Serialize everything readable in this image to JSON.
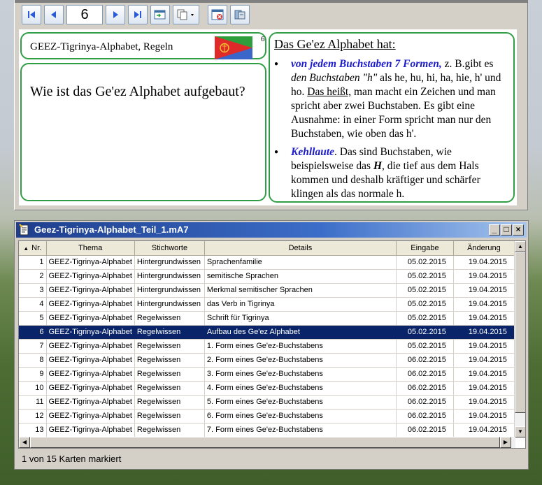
{
  "toolbar": {
    "page_number": "6",
    "buttons": [
      "first-page-icon",
      "prev-page-icon",
      "next-page-icon",
      "last-page-icon",
      "edit-card-icon",
      "copy-dropdown-icon",
      "close-card-icon",
      "export-icon"
    ]
  },
  "card": {
    "title": "GEEZ-Tigrinya-Alphabet, Regeln",
    "card_number": "6",
    "question": "Wie ist das Ge'ez Alphabet aufgebaut?",
    "answer_heading": "Das Ge'ez Alphabet hat:",
    "answer_items": [
      {
        "highlight": "von jedem Buchstaben 7 Formen,",
        "t1": " z. B.gibt es ",
        "italic": "den Buchstaben \"h\"",
        "t2": " als he, hu, hi, ha, hie, h' und ho. ",
        "underlined": "Das heißt,",
        "t3": " man macht ein Zeichen und man spricht aber zwei Buchstaben. Es gibt eine Ausnahme: in einer Form spricht man nur den Buchstaben, wie oben das h'."
      },
      {
        "highlight": "Kehllaute",
        "t1": ". Das sind Buchstaben, wie beispielsweise das ",
        "bold_italic": "H",
        "t2": ", die tief aus dem Hals kommen und deshalb kräftiger und schärfer klingen als das normale h."
      }
    ]
  },
  "list_window": {
    "title": "Geez-Tigrinya-Alphabet_Teil_1.mA7",
    "controls": {
      "minimize": "_",
      "maximize": "□",
      "close": "×"
    },
    "columns": [
      "Nr.",
      "Thema",
      "Stichworte",
      "Details",
      "Eingabe",
      "Änderung"
    ],
    "rows": [
      [
        "1",
        "GEEZ-Tigrinya-Alphabet",
        "Hintergrundwissen",
        "Sprachenfamilie",
        "05.02.2015",
        "19.04.2015"
      ],
      [
        "2",
        "GEEZ-Tigrinya-Alphabet",
        "Hintergrundwissen",
        "semitische Sprachen",
        "05.02.2015",
        "19.04.2015"
      ],
      [
        "3",
        "GEEZ-Tigrinya-Alphabet",
        "Hintergrundwissen",
        "Merkmal  semitischer Sprachen",
        "05.02.2015",
        "19.04.2015"
      ],
      [
        "4",
        "GEEZ-Tigrinya-Alphabet",
        "Hintergrundwissen",
        "das Verb in Tigrinya",
        "05.02.2015",
        "19.04.2015"
      ],
      [
        "5",
        "GEEZ-Tigrinya-Alphabet",
        "Regelwissen",
        "Schrift für Tigrinya",
        "05.02.2015",
        "19.04.2015"
      ],
      [
        "6",
        "GEEZ-Tigrinya-Alphabet",
        "Regelwissen",
        "Aufbau des Ge'ez Alphabet",
        "05.02.2015",
        "19.04.2015"
      ],
      [
        "7",
        "GEEZ-Tigrinya-Alphabet",
        "Regelwissen",
        "1. Form eines Ge'ez-Buchstabens",
        "05.02.2015",
        "19.04.2015"
      ],
      [
        "8",
        "GEEZ-Tigrinya-Alphabet",
        "Regelwissen",
        "2. Form eines Ge'ez-Buchstabens",
        "06.02.2015",
        "19.04.2015"
      ],
      [
        "9",
        "GEEZ-Tigrinya-Alphabet",
        "Regelwissen",
        "3. Form eines Ge'ez-Buchstabens",
        "06.02.2015",
        "19.04.2015"
      ],
      [
        "10",
        "GEEZ-Tigrinya-Alphabet",
        "Regelwissen",
        "4. Form eines Ge'ez-Buchstabens",
        "06.02.2015",
        "19.04.2015"
      ],
      [
        "11",
        "GEEZ-Tigrinya-Alphabet",
        "Regelwissen",
        "5. Form eines Ge'ez-Buchstabens",
        "06.02.2015",
        "19.04.2015"
      ],
      [
        "12",
        "GEEZ-Tigrinya-Alphabet",
        "Regelwissen",
        "6. Form eines Ge'ez-Buchstabens",
        "06.02.2015",
        "19.04.2015"
      ],
      [
        "13",
        "GEEZ-Tigrinya-Alphabet",
        "Regelwissen",
        "7. Form eines Ge'ez-Buchstabens",
        "06.02.2015",
        "19.04.2015"
      ]
    ],
    "selected_row": 5,
    "status": "1 von 15 Karten markiert"
  },
  "colors": {
    "card_border": "#2f9e44",
    "highlight_text": "#1c1ccc",
    "selection": "#0a246a"
  }
}
